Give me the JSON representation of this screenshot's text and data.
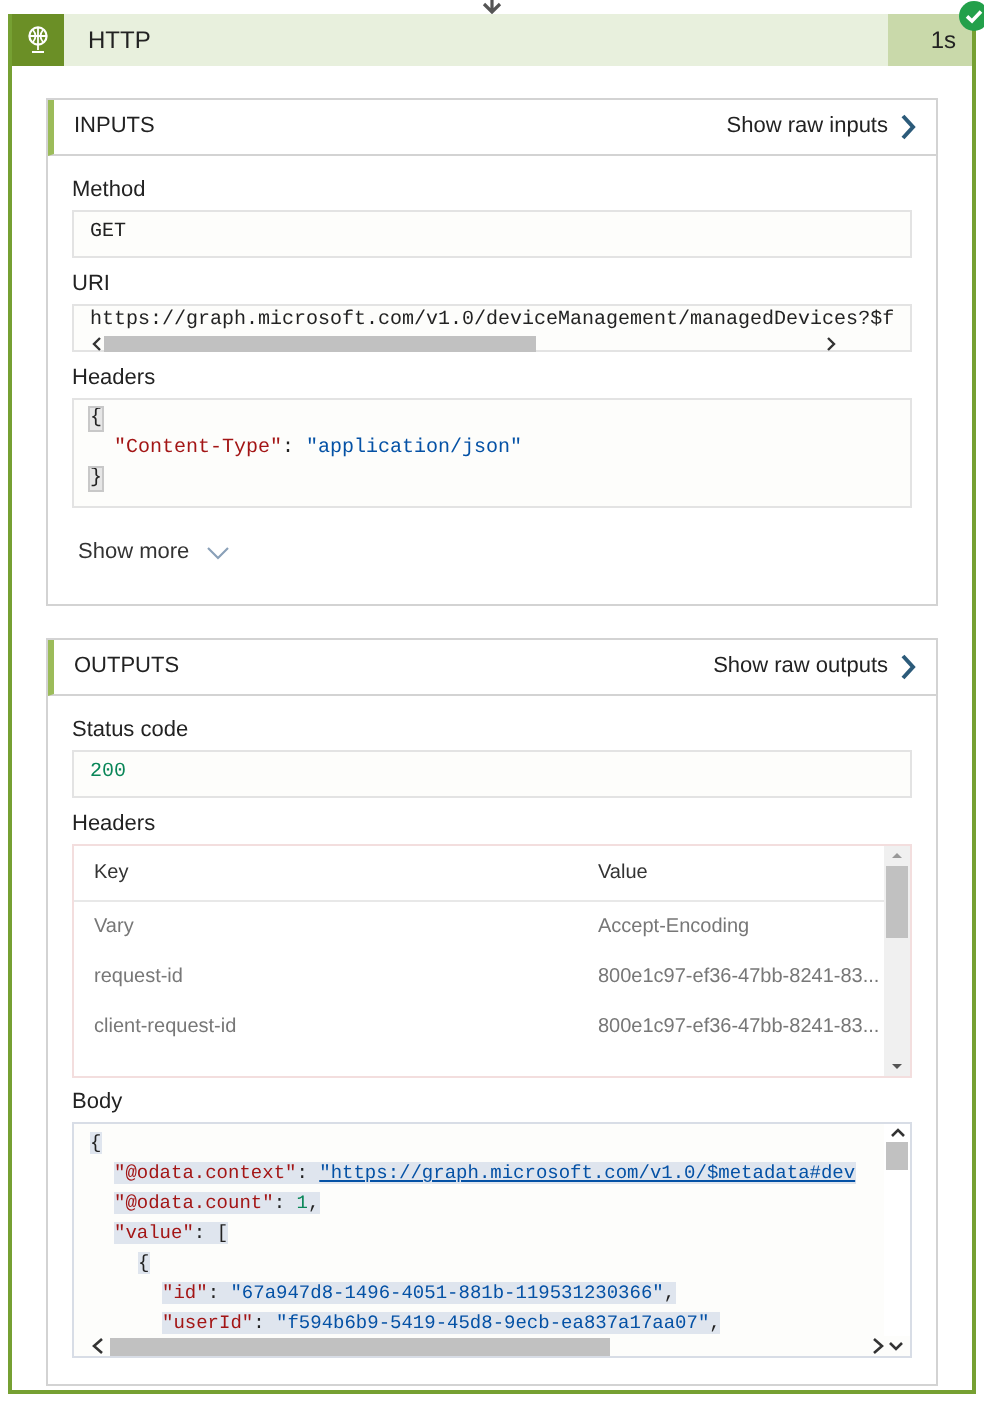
{
  "action": {
    "title": "HTTP",
    "duration": "1s",
    "succeeded": true
  },
  "inputs": {
    "title": "INPUTS",
    "raw_link": "Show raw inputs",
    "fields": [
      {
        "kind": "text",
        "label": "Method",
        "value": "GET"
      },
      {
        "kind": "scroll",
        "label": "URI",
        "value": "https://graph.microsoft.com/v1.0/deviceManagement/managedDevices?$f"
      },
      {
        "kind": "code",
        "label": "Headers",
        "selected": false,
        "lines": [
          {
            "tokens": [
              {
                "t": "{",
                "kind": "brace"
              }
            ],
            "children": [
              {
                "tokens": [
                  {
                    "t": "\"Content-Type\"",
                    "kind": "key"
                  },
                  {
                    "t": ": "
                  },
                  {
                    "t": "\"application/json\"",
                    "kind": "string"
                  }
                ]
              }
            ]
          },
          {
            "tokens": [
              {
                "t": "}",
                "kind": "brace"
              }
            ]
          }
        ]
      }
    ],
    "show_more": "Show more"
  },
  "outputs": {
    "title": "OUTPUTS",
    "raw_link": "Show raw outputs",
    "fields": [
      {
        "kind": "status",
        "label": "Status code",
        "value": "200"
      },
      {
        "kind": "table",
        "label": "Headers",
        "columns": [
          "Key",
          "Value"
        ],
        "rows": [
          [
            "Vary",
            "Accept-Encoding"
          ],
          [
            "request-id",
            "800e1c97-ef36-47bb-8241-83..."
          ],
          [
            "client-request-id",
            "800e1c97-ef36-47bb-8241-83..."
          ]
        ]
      },
      {
        "kind": "code",
        "label": "Body",
        "selected": true,
        "lines": [
          {
            "tokens": [
              {
                "t": "{"
              }
            ],
            "children": [
              {
                "tokens": [
                  {
                    "t": "\"@odata.context\"",
                    "kind": "key"
                  },
                  {
                    "t": ": "
                  },
                  {
                    "t": "\"https://graph.microsoft.com/v1.0/$metadata#dev",
                    "kind": "link"
                  }
                ]
              },
              {
                "tokens": [
                  {
                    "t": "\"@odata.count\"",
                    "kind": "key"
                  },
                  {
                    "t": ": "
                  },
                  {
                    "t": "1",
                    "kind": "number"
                  },
                  {
                    "t": ","
                  }
                ]
              },
              {
                "tokens": [
                  {
                    "t": "\"value\"",
                    "kind": "key"
                  },
                  {
                    "t": ": ["
                  }
                ],
                "children": [
                  {
                    "tokens": [
                      {
                        "t": "{"
                      }
                    ],
                    "children": [
                      {
                        "tokens": [
                          {
                            "t": "\"id\"",
                            "kind": "key"
                          },
                          {
                            "t": ": "
                          },
                          {
                            "t": "\"67a947d8-1496-4051-881b-119531230366\"",
                            "kind": "string"
                          },
                          {
                            "t": ","
                          }
                        ]
                      },
                      {
                        "tokens": [
                          {
                            "t": "\"userId\"",
                            "kind": "key"
                          },
                          {
                            "t": ": "
                          },
                          {
                            "t": "\"f594b6b9-5419-45d8-9ecb-ea837a17aa07\"",
                            "kind": "string"
                          },
                          {
                            "t": ","
                          }
                        ]
                      }
                    ]
                  }
                ]
              }
            ]
          }
        ]
      }
    ]
  }
}
